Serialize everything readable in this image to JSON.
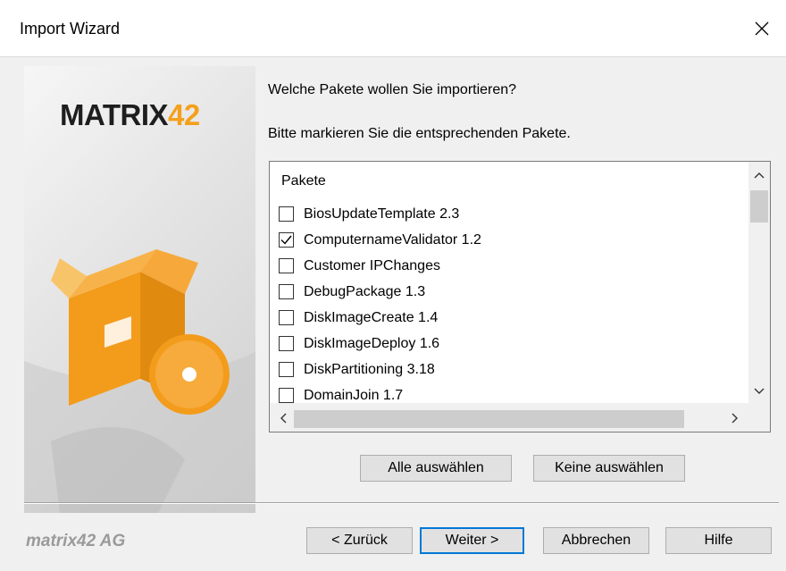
{
  "window": {
    "title": "Import Wizard"
  },
  "branding": {
    "logo_text": "MATRIX",
    "logo_number": "42",
    "company": "matrix42 AG",
    "accent_color": "#f4a01c"
  },
  "page": {
    "question": "Welche Pakete wollen Sie importieren?",
    "instruction": "Bitte markieren Sie die entsprechenden Pakete."
  },
  "packages": {
    "header": "Pakete",
    "items": [
      {
        "label": "BiosUpdateTemplate 2.3",
        "checked": false
      },
      {
        "label": "ComputernameValidator 1.2",
        "checked": true
      },
      {
        "label": "Customer IPChanges",
        "checked": false
      },
      {
        "label": "DebugPackage 1.3",
        "checked": false
      },
      {
        "label": "DiskImageCreate 1.4",
        "checked": false
      },
      {
        "label": "DiskImageDeploy 1.6",
        "checked": false
      },
      {
        "label": "DiskPartitioning 3.18",
        "checked": false
      },
      {
        "label": "DomainJoin 1.7",
        "checked": false
      }
    ]
  },
  "selection": {
    "select_all": "Alle auswählen",
    "select_none": "Keine auswählen"
  },
  "footer": {
    "back": "< Zurück",
    "next": "Weiter >",
    "cancel": "Abbrechen",
    "help": "Hilfe"
  }
}
